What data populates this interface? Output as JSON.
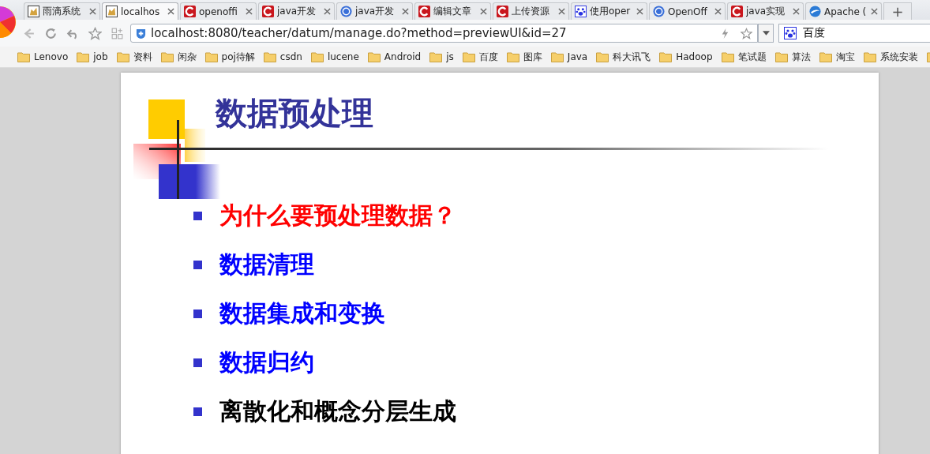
{
  "tabs": [
    {
      "title": "雨滴系统",
      "kind": "cat",
      "selected": false
    },
    {
      "title": "localhos",
      "kind": "cat",
      "selected": true
    },
    {
      "title": "openoffi",
      "kind": "csdn",
      "selected": false
    },
    {
      "title": "java开发",
      "kind": "csdn",
      "selected": false
    },
    {
      "title": "java开发",
      "kind": "globe",
      "selected": false
    },
    {
      "title": "编辑文章",
      "kind": "csdn",
      "selected": false
    },
    {
      "title": "上传资源",
      "kind": "csdn",
      "selected": false
    },
    {
      "title": "使用oper",
      "kind": "paw",
      "selected": false
    },
    {
      "title": "OpenOff",
      "kind": "globe",
      "selected": false
    },
    {
      "title": "java实现",
      "kind": "csdn",
      "selected": false
    },
    {
      "title": "Apache (",
      "kind": "bird",
      "selected": false
    }
  ],
  "new_tab": "+",
  "address": "localhost:8080/teacher/datum/manage.do?method=previewUI&id=27",
  "search_engine": "百度",
  "bookmarks": [
    "Lenovo",
    "job",
    "资料",
    "闲杂",
    "poj待解",
    "csdn",
    "lucene",
    "Android",
    "js",
    "百度",
    "图库",
    "Java",
    "科大讯飞",
    "Hadoop",
    "笔试题",
    "算法",
    "淘宝",
    "系统安装"
  ],
  "slide": {
    "title": "数据预处理",
    "items": [
      {
        "text": "为什么要预处理数据？",
        "color": "#ff0000"
      },
      {
        "text": "数据清理",
        "color": "#0000ff"
      },
      {
        "text": "数据集成和变换",
        "color": "#0000ff"
      },
      {
        "text": "数据归约",
        "color": "#0000ff"
      },
      {
        "text": "离散化和概念分层生成",
        "color": "#000000"
      }
    ]
  }
}
